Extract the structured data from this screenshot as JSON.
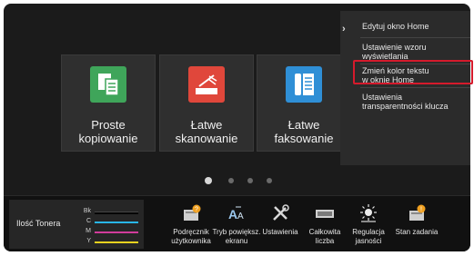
{
  "tiles": [
    {
      "label": "Proste\nkopiowanie",
      "icon": "copy-icon",
      "color": "#3fa55a"
    },
    {
      "label": "Łatwe\nskanowanie",
      "icon": "scanner-icon",
      "color": "#e0473b"
    },
    {
      "label": "Łatwe\nfaksowanie",
      "icon": "fax-icon",
      "color": "#2f8fd6"
    }
  ],
  "pager": {
    "active_page": 1,
    "page_count": 4
  },
  "toner": {
    "title": "Ilość Tonera",
    "channels": [
      {
        "label": "Bk",
        "color": "#1a1a1a"
      },
      {
        "label": "C",
        "color": "#29b6e8"
      },
      {
        "label": "M",
        "color": "#d23c9b"
      },
      {
        "label": "Y",
        "color": "#e8d21f"
      }
    ]
  },
  "bottom_items": [
    {
      "label": "Podręcznik\nużytkownika",
      "icon": "manual-icon"
    },
    {
      "label": "Tryb powiększ.\nekranu",
      "icon": "zoom-text-icon"
    },
    {
      "label": "Ustawienia",
      "icon": "tools-icon"
    },
    {
      "label": "Całkowita\nliczba",
      "icon": "counter-icon"
    },
    {
      "label": "Regulacja\njasności",
      "icon": "brightness-icon"
    },
    {
      "label": "Stan zadania",
      "icon": "job-status-icon"
    }
  ],
  "menu": {
    "toggle_icon": "chevron-right-icon",
    "items": [
      {
        "label": "Edytuj okno Home"
      },
      {
        "label": "Ustawienie wzoru\nwyświetlania"
      },
      {
        "label": "Zmień kolor tekstu\nw oknie Home"
      },
      {
        "label": "Ustawienia\ntransparentności klucza"
      }
    ],
    "highlight_color": "#d51a2c"
  }
}
